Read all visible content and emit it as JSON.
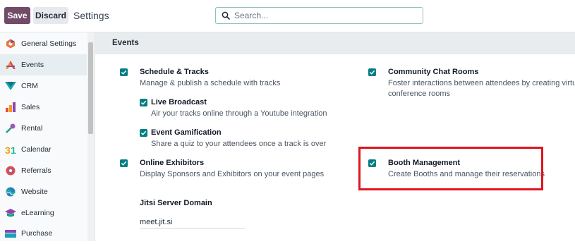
{
  "toolbar": {
    "save_label": "Save",
    "discard_label": "Discard",
    "title": "Settings"
  },
  "search": {
    "placeholder": "Search..."
  },
  "sidebar": {
    "items": [
      {
        "label": "General Settings",
        "icon": "odoo-logo-icon",
        "active": false
      },
      {
        "label": "Events",
        "icon": "events-icon",
        "active": true
      },
      {
        "label": "CRM",
        "icon": "crm-icon",
        "active": false
      },
      {
        "label": "Sales",
        "icon": "sales-chart-icon",
        "active": false
      },
      {
        "label": "Rental",
        "icon": "rental-key-icon",
        "active": false
      },
      {
        "label": "Calendar",
        "icon": "calendar-icon",
        "active": false
      },
      {
        "label": "Referrals",
        "icon": "referrals-icon",
        "active": false
      },
      {
        "label": "Website",
        "icon": "website-globe-icon",
        "active": false
      },
      {
        "label": "eLearning",
        "icon": "elearning-cap-icon",
        "active": false
      },
      {
        "label": "Purchase",
        "icon": "purchase-icon",
        "active": false
      }
    ]
  },
  "section": {
    "title": "Events"
  },
  "options": {
    "schedule": {
      "title": "Schedule & Tracks",
      "desc": "Manage & publish a schedule with tracks",
      "checked": true
    },
    "live": {
      "title": "Live Broadcast",
      "desc": "Air your tracks online through a Youtube integration",
      "checked": true
    },
    "gamification": {
      "title": "Event Gamification",
      "desc": "Share a quiz to your attendees once a track is over",
      "checked": true
    },
    "exhibitors": {
      "title": "Online Exhibitors",
      "desc": "Display Sponsors and Exhibitors on your event pages",
      "checked": true
    },
    "community": {
      "title": "Community Chat Rooms",
      "desc_line1": "Foster interactions between attendees by creating virtual",
      "desc_line2": "conference rooms",
      "checked": true
    },
    "booth": {
      "title": "Booth Management",
      "desc": "Create Booths and manage their reservations",
      "checked": true
    }
  },
  "jitsi": {
    "label": "Jitsi Server Domain",
    "value": "meet.jit.si"
  },
  "colors": {
    "brand": "#714b67",
    "checkbox": "#017e84",
    "highlight": "#e0141e"
  }
}
